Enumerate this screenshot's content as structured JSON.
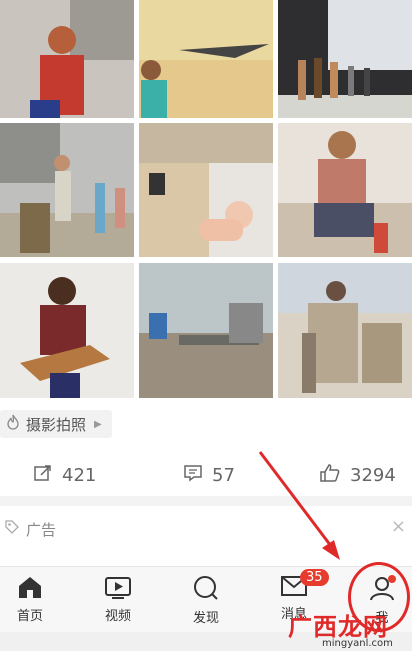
{
  "post": {
    "tag_label": "摄影拍照",
    "share_count": "421",
    "comment_count": "57",
    "like_count": "3294"
  },
  "ad": {
    "label": "广告",
    "close": "×"
  },
  "tabbar": {
    "items": [
      {
        "label": "首页",
        "icon": "home-icon"
      },
      {
        "label": "视频",
        "icon": "video-icon"
      },
      {
        "label": "发现",
        "icon": "search-icon"
      },
      {
        "label": "消息",
        "icon": "mail-icon",
        "badge": "35"
      },
      {
        "label": "我",
        "icon": "user-icon"
      }
    ]
  },
  "watermark": {
    "text": "广西龙网",
    "url": "mingyanl.com"
  },
  "colors": {
    "accent": "#e63c2e",
    "annotation": "#e02a2a"
  }
}
